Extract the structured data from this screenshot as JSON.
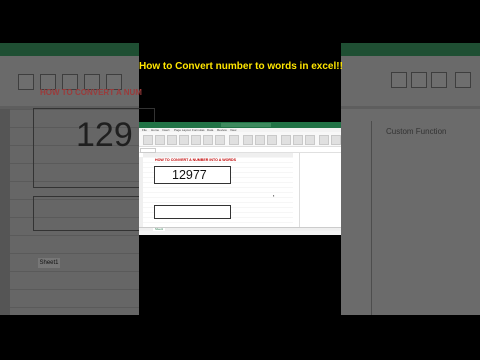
{
  "video": {
    "caption": "How to Convert number to words in excel!!"
  },
  "background_left": {
    "heading": "HOW TO CONVERT A NUM",
    "number": "129",
    "sheet_tab": "Sheet1"
  },
  "background_right": {
    "pane_title": "Custom Function"
  },
  "excel": {
    "window_title": "Book1 - Excel",
    "ribbon_tabs": [
      "File",
      "Home",
      "Insert",
      "Page Layout",
      "Formulas",
      "Data",
      "Review",
      "View"
    ],
    "sheet_heading": "HOW TO CONVERT A NUMBER INTO A WORDS",
    "number_value": "12977",
    "words_value": "",
    "sheet_tab": "Sheet1",
    "accent_color": "#217346",
    "heading_color": "#c00000"
  }
}
